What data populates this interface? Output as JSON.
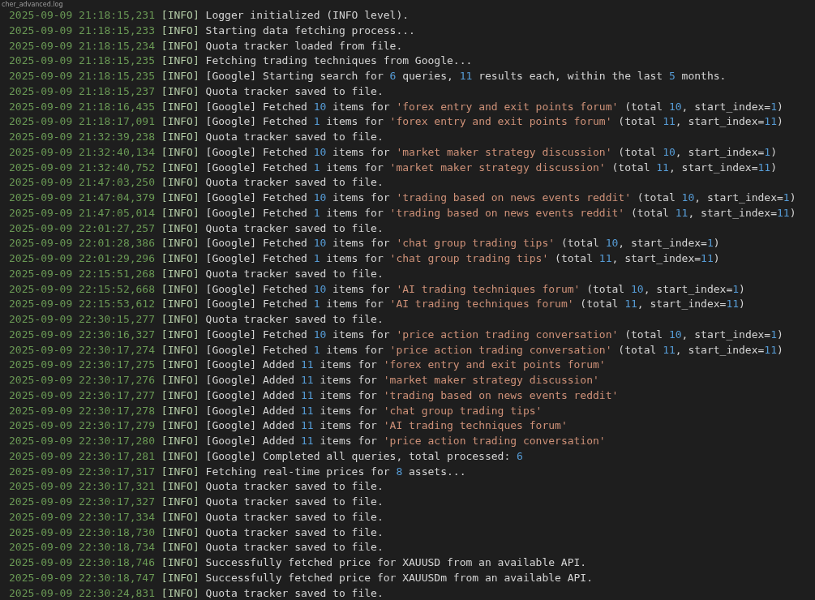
{
  "tab": {
    "title": "cher_advanced.log"
  },
  "lines": [
    {
      "time": "2025-09-09 21:18:15,231",
      "level": "[INFO]",
      "parts": [
        {
          "kind": "text",
          "text": "Logger initialized (INFO level)."
        }
      ]
    },
    {
      "time": "2025-09-09 21:18:15,233",
      "level": "[INFO]",
      "parts": [
        {
          "kind": "text",
          "text": "Starting data fetching process..."
        }
      ]
    },
    {
      "time": "2025-09-09 21:18:15,234",
      "level": "[INFO]",
      "parts": [
        {
          "kind": "text",
          "text": "Quota tracker loaded from file."
        }
      ]
    },
    {
      "time": "2025-09-09 21:18:15,235",
      "level": "[INFO]",
      "parts": [
        {
          "kind": "text",
          "text": "Fetching trading techniques from Google..."
        }
      ]
    },
    {
      "time": "2025-09-09 21:18:15,235",
      "level": "[INFO]",
      "parts": [
        {
          "kind": "text",
          "text": "[Google] Starting search for "
        },
        {
          "kind": "number",
          "text": "6"
        },
        {
          "kind": "text",
          "text": " queries, "
        },
        {
          "kind": "number",
          "text": "11"
        },
        {
          "kind": "text",
          "text": " results each, within the last "
        },
        {
          "kind": "number",
          "text": "5"
        },
        {
          "kind": "text",
          "text": " months."
        }
      ]
    },
    {
      "time": "2025-09-09 21:18:15,237",
      "level": "[INFO]",
      "parts": [
        {
          "kind": "text",
          "text": "Quota tracker saved to file."
        }
      ]
    },
    {
      "time": "2025-09-09 21:18:16,435",
      "level": "[INFO]",
      "parts": [
        {
          "kind": "text",
          "text": "[Google] Fetched "
        },
        {
          "kind": "number",
          "text": "10"
        },
        {
          "kind": "text",
          "text": " items for "
        },
        {
          "kind": "string",
          "text": "'forex entry and exit points forum'"
        },
        {
          "kind": "text",
          "text": " (total "
        },
        {
          "kind": "number",
          "text": "10"
        },
        {
          "kind": "text",
          "text": ", start_index="
        },
        {
          "kind": "number",
          "text": "1"
        },
        {
          "kind": "text",
          "text": ")"
        }
      ]
    },
    {
      "time": "2025-09-09 21:18:17,091",
      "level": "[INFO]",
      "parts": [
        {
          "kind": "text",
          "text": "[Google] Fetched "
        },
        {
          "kind": "number",
          "text": "1"
        },
        {
          "kind": "text",
          "text": " items for "
        },
        {
          "kind": "string",
          "text": "'forex entry and exit points forum'"
        },
        {
          "kind": "text",
          "text": " (total "
        },
        {
          "kind": "number",
          "text": "11"
        },
        {
          "kind": "text",
          "text": ", start_index="
        },
        {
          "kind": "number",
          "text": "11"
        },
        {
          "kind": "text",
          "text": ")"
        }
      ]
    },
    {
      "time": "2025-09-09 21:32:39,238",
      "level": "[INFO]",
      "parts": [
        {
          "kind": "text",
          "text": "Quota tracker saved to file."
        }
      ]
    },
    {
      "time": "2025-09-09 21:32:40,134",
      "level": "[INFO]",
      "parts": [
        {
          "kind": "text",
          "text": "[Google] Fetched "
        },
        {
          "kind": "number",
          "text": "10"
        },
        {
          "kind": "text",
          "text": " items for "
        },
        {
          "kind": "string",
          "text": "'market maker strategy discussion'"
        },
        {
          "kind": "text",
          "text": " (total "
        },
        {
          "kind": "number",
          "text": "10"
        },
        {
          "kind": "text",
          "text": ", start_index="
        },
        {
          "kind": "number",
          "text": "1"
        },
        {
          "kind": "text",
          "text": ")"
        }
      ]
    },
    {
      "time": "2025-09-09 21:32:40,752",
      "level": "[INFO]",
      "parts": [
        {
          "kind": "text",
          "text": "[Google] Fetched "
        },
        {
          "kind": "number",
          "text": "1"
        },
        {
          "kind": "text",
          "text": " items for "
        },
        {
          "kind": "string",
          "text": "'market maker strategy discussion'"
        },
        {
          "kind": "text",
          "text": " (total "
        },
        {
          "kind": "number",
          "text": "11"
        },
        {
          "kind": "text",
          "text": ", start_index="
        },
        {
          "kind": "number",
          "text": "11"
        },
        {
          "kind": "text",
          "text": ")"
        }
      ]
    },
    {
      "time": "2025-09-09 21:47:03,250",
      "level": "[INFO]",
      "parts": [
        {
          "kind": "text",
          "text": "Quota tracker saved to file."
        }
      ]
    },
    {
      "time": "2025-09-09 21:47:04,379",
      "level": "[INFO]",
      "parts": [
        {
          "kind": "text",
          "text": "[Google] Fetched "
        },
        {
          "kind": "number",
          "text": "10"
        },
        {
          "kind": "text",
          "text": " items for "
        },
        {
          "kind": "string",
          "text": "'trading based on news events reddit'"
        },
        {
          "kind": "text",
          "text": " (total "
        },
        {
          "kind": "number",
          "text": "10"
        },
        {
          "kind": "text",
          "text": ", start_index="
        },
        {
          "kind": "number",
          "text": "1"
        },
        {
          "kind": "text",
          "text": ")"
        }
      ]
    },
    {
      "time": "2025-09-09 21:47:05,014",
      "level": "[INFO]",
      "parts": [
        {
          "kind": "text",
          "text": "[Google] Fetched "
        },
        {
          "kind": "number",
          "text": "1"
        },
        {
          "kind": "text",
          "text": " items for "
        },
        {
          "kind": "string",
          "text": "'trading based on news events reddit'"
        },
        {
          "kind": "text",
          "text": " (total "
        },
        {
          "kind": "number",
          "text": "11"
        },
        {
          "kind": "text",
          "text": ", start_index="
        },
        {
          "kind": "number",
          "text": "11"
        },
        {
          "kind": "text",
          "text": ")"
        }
      ]
    },
    {
      "time": "2025-09-09 22:01:27,257",
      "level": "[INFO]",
      "parts": [
        {
          "kind": "text",
          "text": "Quota tracker saved to file."
        }
      ]
    },
    {
      "time": "2025-09-09 22:01:28,386",
      "level": "[INFO]",
      "parts": [
        {
          "kind": "text",
          "text": "[Google] Fetched "
        },
        {
          "kind": "number",
          "text": "10"
        },
        {
          "kind": "text",
          "text": " items for "
        },
        {
          "kind": "string",
          "text": "'chat group trading tips'"
        },
        {
          "kind": "text",
          "text": " (total "
        },
        {
          "kind": "number",
          "text": "10"
        },
        {
          "kind": "text",
          "text": ", start_index="
        },
        {
          "kind": "number",
          "text": "1"
        },
        {
          "kind": "text",
          "text": ")"
        }
      ]
    },
    {
      "time": "2025-09-09 22:01:29,296",
      "level": "[INFO]",
      "parts": [
        {
          "kind": "text",
          "text": "[Google] Fetched "
        },
        {
          "kind": "number",
          "text": "1"
        },
        {
          "kind": "text",
          "text": " items for "
        },
        {
          "kind": "string",
          "text": "'chat group trading tips'"
        },
        {
          "kind": "text",
          "text": " (total "
        },
        {
          "kind": "number",
          "text": "11"
        },
        {
          "kind": "text",
          "text": ", start_index="
        },
        {
          "kind": "number",
          "text": "11"
        },
        {
          "kind": "text",
          "text": ")"
        }
      ]
    },
    {
      "time": "2025-09-09 22:15:51,268",
      "level": "[INFO]",
      "parts": [
        {
          "kind": "text",
          "text": "Quota tracker saved to file."
        }
      ]
    },
    {
      "time": "2025-09-09 22:15:52,668",
      "level": "[INFO]",
      "parts": [
        {
          "kind": "text",
          "text": "[Google] Fetched "
        },
        {
          "kind": "number",
          "text": "10"
        },
        {
          "kind": "text",
          "text": " items for "
        },
        {
          "kind": "string",
          "text": "'AI trading techniques forum'"
        },
        {
          "kind": "text",
          "text": " (total "
        },
        {
          "kind": "number",
          "text": "10"
        },
        {
          "kind": "text",
          "text": ", start_index="
        },
        {
          "kind": "number",
          "text": "1"
        },
        {
          "kind": "text",
          "text": ")"
        }
      ]
    },
    {
      "time": "2025-09-09 22:15:53,612",
      "level": "[INFO]",
      "parts": [
        {
          "kind": "text",
          "text": "[Google] Fetched "
        },
        {
          "kind": "number",
          "text": "1"
        },
        {
          "kind": "text",
          "text": " items for "
        },
        {
          "kind": "string",
          "text": "'AI trading techniques forum'"
        },
        {
          "kind": "text",
          "text": " (total "
        },
        {
          "kind": "number",
          "text": "11"
        },
        {
          "kind": "text",
          "text": ", start_index="
        },
        {
          "kind": "number",
          "text": "11"
        },
        {
          "kind": "text",
          "text": ")"
        }
      ]
    },
    {
      "time": "2025-09-09 22:30:15,277",
      "level": "[INFO]",
      "parts": [
        {
          "kind": "text",
          "text": "Quota tracker saved to file."
        }
      ]
    },
    {
      "time": "2025-09-09 22:30:16,327",
      "level": "[INFO]",
      "parts": [
        {
          "kind": "text",
          "text": "[Google] Fetched "
        },
        {
          "kind": "number",
          "text": "10"
        },
        {
          "kind": "text",
          "text": " items for "
        },
        {
          "kind": "string",
          "text": "'price action trading conversation'"
        },
        {
          "kind": "text",
          "text": " (total "
        },
        {
          "kind": "number",
          "text": "10"
        },
        {
          "kind": "text",
          "text": ", start_index="
        },
        {
          "kind": "number",
          "text": "1"
        },
        {
          "kind": "text",
          "text": ")"
        }
      ]
    },
    {
      "time": "2025-09-09 22:30:17,274",
      "level": "[INFO]",
      "parts": [
        {
          "kind": "text",
          "text": "[Google] Fetched "
        },
        {
          "kind": "number",
          "text": "1"
        },
        {
          "kind": "text",
          "text": " items for "
        },
        {
          "kind": "string",
          "text": "'price action trading conversation'"
        },
        {
          "kind": "text",
          "text": " (total "
        },
        {
          "kind": "number",
          "text": "11"
        },
        {
          "kind": "text",
          "text": ", start_index="
        },
        {
          "kind": "number",
          "text": "11"
        },
        {
          "kind": "text",
          "text": ")"
        }
      ]
    },
    {
      "time": "2025-09-09 22:30:17,275",
      "level": "[INFO]",
      "parts": [
        {
          "kind": "text",
          "text": "[Google] Added "
        },
        {
          "kind": "number",
          "text": "11"
        },
        {
          "kind": "text",
          "text": " items for "
        },
        {
          "kind": "string",
          "text": "'forex entry and exit points forum'"
        }
      ]
    },
    {
      "time": "2025-09-09 22:30:17,276",
      "level": "[INFO]",
      "parts": [
        {
          "kind": "text",
          "text": "[Google] Added "
        },
        {
          "kind": "number",
          "text": "11"
        },
        {
          "kind": "text",
          "text": " items for "
        },
        {
          "kind": "string",
          "text": "'market maker strategy discussion'"
        }
      ]
    },
    {
      "time": "2025-09-09 22:30:17,277",
      "level": "[INFO]",
      "parts": [
        {
          "kind": "text",
          "text": "[Google] Added "
        },
        {
          "kind": "number",
          "text": "11"
        },
        {
          "kind": "text",
          "text": " items for "
        },
        {
          "kind": "string",
          "text": "'trading based on news events reddit'"
        }
      ]
    },
    {
      "time": "2025-09-09 22:30:17,278",
      "level": "[INFO]",
      "parts": [
        {
          "kind": "text",
          "text": "[Google] Added "
        },
        {
          "kind": "number",
          "text": "11"
        },
        {
          "kind": "text",
          "text": " items for "
        },
        {
          "kind": "string",
          "text": "'chat group trading tips'"
        }
      ]
    },
    {
      "time": "2025-09-09 22:30:17,279",
      "level": "[INFO]",
      "parts": [
        {
          "kind": "text",
          "text": "[Google] Added "
        },
        {
          "kind": "number",
          "text": "11"
        },
        {
          "kind": "text",
          "text": " items for "
        },
        {
          "kind": "string",
          "text": "'AI trading techniques forum'"
        }
      ]
    },
    {
      "time": "2025-09-09 22:30:17,280",
      "level": "[INFO]",
      "parts": [
        {
          "kind": "text",
          "text": "[Google] Added "
        },
        {
          "kind": "number",
          "text": "11"
        },
        {
          "kind": "text",
          "text": " items for "
        },
        {
          "kind": "string",
          "text": "'price action trading conversation'"
        }
      ]
    },
    {
      "time": "2025-09-09 22:30:17,281",
      "level": "[INFO]",
      "parts": [
        {
          "kind": "text",
          "text": "[Google] Completed all queries, total processed: "
        },
        {
          "kind": "number",
          "text": "6"
        }
      ]
    },
    {
      "time": "2025-09-09 22:30:17,317",
      "level": "[INFO]",
      "parts": [
        {
          "kind": "text",
          "text": "Fetching real-time prices for "
        },
        {
          "kind": "number",
          "text": "8"
        },
        {
          "kind": "text",
          "text": " assets..."
        }
      ]
    },
    {
      "time": "2025-09-09 22:30:17,321",
      "level": "[INFO]",
      "parts": [
        {
          "kind": "text",
          "text": "Quota tracker saved to file."
        }
      ]
    },
    {
      "time": "2025-09-09 22:30:17,327",
      "level": "[INFO]",
      "parts": [
        {
          "kind": "text",
          "text": "Quota tracker saved to file."
        }
      ]
    },
    {
      "time": "2025-09-09 22:30:17,334",
      "level": "[INFO]",
      "parts": [
        {
          "kind": "text",
          "text": "Quota tracker saved to file."
        }
      ]
    },
    {
      "time": "2025-09-09 22:30:18,730",
      "level": "[INFO]",
      "parts": [
        {
          "kind": "text",
          "text": "Quota tracker saved to file."
        }
      ]
    },
    {
      "time": "2025-09-09 22:30:18,734",
      "level": "[INFO]",
      "parts": [
        {
          "kind": "text",
          "text": "Quota tracker saved to file."
        }
      ]
    },
    {
      "time": "2025-09-09 22:30:18,746",
      "level": "[INFO]",
      "parts": [
        {
          "kind": "text",
          "text": "Successfully fetched price for XAUUSD from an available API."
        }
      ]
    },
    {
      "time": "2025-09-09 22:30:18,747",
      "level": "[INFO]",
      "parts": [
        {
          "kind": "text",
          "text": "Successfully fetched price for XAUUSDm from an available API."
        }
      ]
    },
    {
      "time": "2025-09-09 22:30:24,831",
      "level": "[INFO]",
      "parts": [
        {
          "kind": "text",
          "text": "Quota tracker saved to file."
        }
      ]
    }
  ]
}
